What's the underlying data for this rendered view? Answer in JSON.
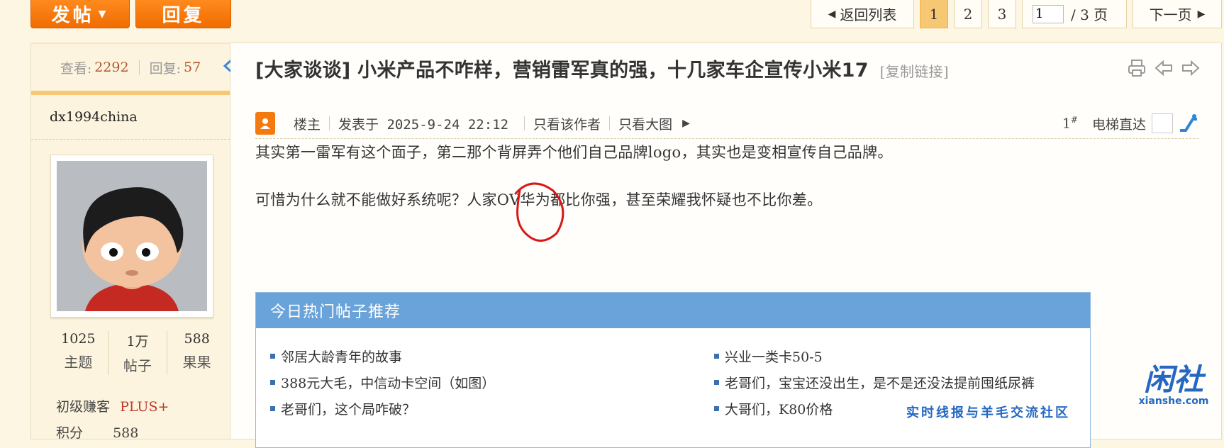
{
  "toolbar": {
    "post_label": "发帖",
    "reply_label": "回复"
  },
  "pager": {
    "back_label": "返回列表",
    "pages": [
      "1",
      "2",
      "3"
    ],
    "current_page": "1",
    "page_input": "1",
    "total_label": "/ 3 页",
    "next_label": "下一页"
  },
  "stats_bar": {
    "views_label": "查看:",
    "views_value": "2292",
    "replies_label": "回复:",
    "replies_value": "57"
  },
  "author": {
    "username": "dx1994china",
    "stats": [
      {
        "value": "1025",
        "label": "主题"
      },
      {
        "value": "1万",
        "label": "帖子"
      },
      {
        "value": "588",
        "label": "果果"
      }
    ],
    "rank_label": "初级赚客",
    "rank_badge": "PLUS+",
    "points_label": "积分",
    "points_value": "588"
  },
  "thread": {
    "title": "[大家谈谈] 小米产品不咋样，营销雷军真的强，十几家车企宣传小米17",
    "copy_link": "[复制链接]"
  },
  "post_meta": {
    "floor_owner": "楼主",
    "posted_at": "发表于 2025-9-24 22:12",
    "only_author": "只看该作者",
    "only_images": "只看大图",
    "floor_number": "1",
    "floor_mark": "#",
    "elevator_label": "电梯直达"
  },
  "post": {
    "paragraphs": [
      "其实第一雷军有这个面子，第二那个背屏弄个他们自己品牌logo，其实也是变相宣传自己品牌。",
      "可惜为什么就不能做好系统呢？人家OV华为都比你强，甚至荣耀我怀疑也不比你差。"
    ]
  },
  "hot_topics": {
    "header": "今日热门帖子推荐",
    "left": [
      "邻居大龄青年的故事",
      "388元大毛，中信动卡空间（如图）",
      "老哥们，这个局咋破？"
    ],
    "right": [
      "兴业一类卡50-5",
      "老哥们，宝宝还没出生，是不是还没法提前囤纸尿裤",
      "大哥们，K80价格"
    ]
  },
  "watermark": {
    "logo_text": "闲社",
    "domain": "xianshe.com",
    "slogan": "实时线报与羊毛交流社区"
  },
  "colors": {
    "accent_orange": "#f47a10",
    "pager_active": "#f7c874",
    "hot_header_blue": "#6aa3d9",
    "watermark_blue": "#2468c4",
    "annotation_red": "#d81818"
  }
}
